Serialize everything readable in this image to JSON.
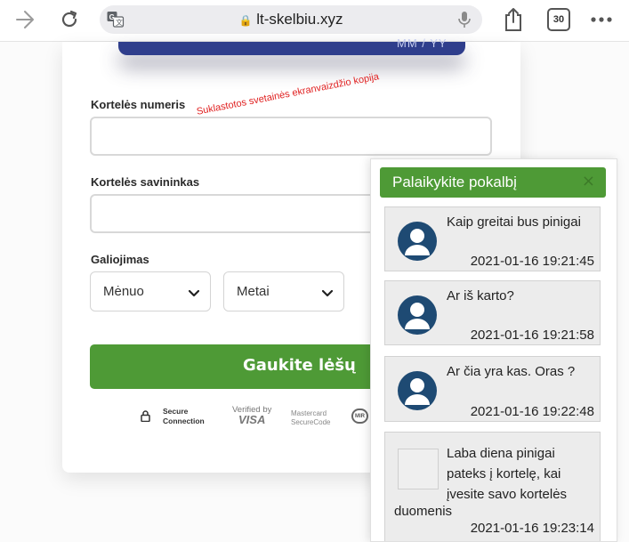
{
  "browser": {
    "url": "lt-skelbiu.xyz",
    "tabs_count": "30",
    "icons": [
      "back-arrow-icon",
      "reload-icon",
      "translate-icon",
      "lock-icon",
      "mic-icon",
      "share-icon",
      "tabs-icon",
      "more-icon"
    ]
  },
  "card_preview": {
    "expiry_hint": "MM / YY"
  },
  "form": {
    "card_number_label": "Kortelės numeris",
    "card_number_value": "",
    "owner_label": "Kortelės savininkas",
    "owner_value": "",
    "expiry_label": "Galiojimas",
    "month_selected": "Mėnuo",
    "year_selected": "Metai",
    "submit_label": "Gaukite lėšų"
  },
  "badges": {
    "secure_line1": "Secure",
    "secure_line2": "Connection",
    "visa_line1": "Verified by",
    "visa_line2": "VISA",
    "mc_line1": "Mastercard",
    "mc_line2": "SecureCode",
    "partial": "MIR"
  },
  "watermark": "Suklastotos svetainės ekranvaizdžio kopija",
  "chat": {
    "title": "Palaikykite pokalbį",
    "close": "×",
    "messages": [
      {
        "text": "Kaip greitai bus pinigai",
        "time": "2021-01-16 19:21:45"
      },
      {
        "text": "Ar iš karto?",
        "time": "2021-01-16 19:21:58"
      },
      {
        "text": "Ar čia yra kas. Oras ?",
        "time": "2021-01-16 19:22:48"
      }
    ],
    "last_message": {
      "text": "Laba diena pinigai pateks į kortelę, kai įvesite savo kortelės",
      "text_end": "duomenis",
      "time": "2021-01-16 19:23:14"
    }
  },
  "colors": {
    "accent_green": "#4e9a36",
    "card_blue": "#2f3e8c",
    "watermark_red": "#e02020",
    "avatar_blue": "#1e4a73"
  }
}
